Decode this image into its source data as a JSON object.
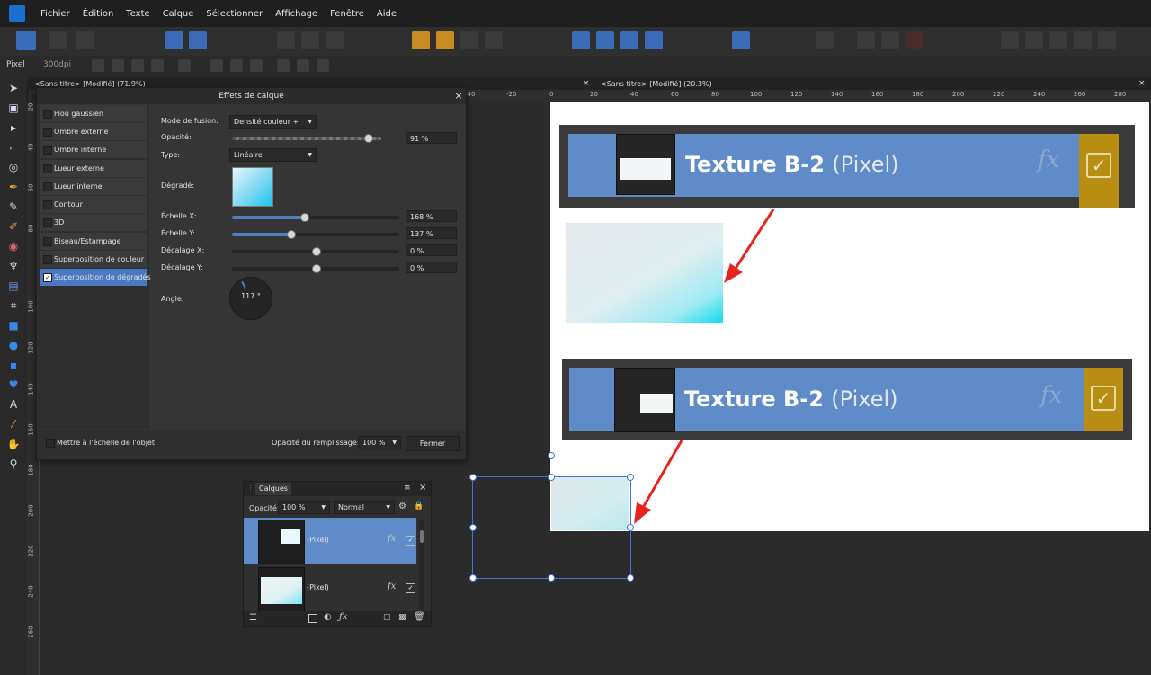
{
  "menubar": {
    "items": [
      "Fichier",
      "Édition",
      "Texte",
      "Calque",
      "Sélectionner",
      "Affichage",
      "Fenêtre",
      "Aide"
    ]
  },
  "contextbar": {
    "unit": "Pixel",
    "dpi": "300dpi"
  },
  "tabs": [
    {
      "label": "<Sans titre> [Modifié] (71.9%)"
    },
    {
      "label": "<Sans titre> [Modifié] (20.3%)"
    }
  ],
  "hruler": [
    "-40",
    "-20",
    "0",
    "20",
    "40",
    "60",
    "80",
    "100",
    "120",
    "140",
    "160",
    "180",
    "200",
    "220",
    "240",
    "260",
    "280"
  ],
  "vruler": [
    "20",
    "40",
    "60",
    "80",
    "100",
    "120",
    "140",
    "160",
    "180",
    "200",
    "220",
    "240",
    "260"
  ],
  "dialog": {
    "title": "Effets de calque",
    "close": "×",
    "effects": [
      {
        "label": "Flou gaussien",
        "checked": false
      },
      {
        "label": "Ombre externe",
        "checked": false
      },
      {
        "label": "Ombre interne",
        "checked": false
      },
      {
        "label": "Lueur externe",
        "checked": false
      },
      {
        "label": "Lueur interne",
        "checked": false
      },
      {
        "label": "Contour",
        "checked": false
      },
      {
        "label": "3D",
        "checked": false
      },
      {
        "label": "Biseau/Estampage",
        "checked": false
      },
      {
        "label": "Superposition de couleur",
        "checked": false
      },
      {
        "label": "Superposition de dégradés",
        "checked": true
      }
    ],
    "blend_label": "Mode de fusion:",
    "blend_value": "Densité couleur +",
    "opacity_label": "Opacité:",
    "opacity_value": "91 %",
    "opacity_level": 0.91,
    "type_label": "Type:",
    "type_value": "Linéaire",
    "gradient_label": "Dégradé:",
    "scale_x_label": "Échelle X:",
    "scale_x_value": "168 %",
    "scale_x_level": 0.43,
    "scale_y_label": "Échelle Y:",
    "scale_y_value": "137 %",
    "scale_y_level": 0.35,
    "offset_x_label": "Décalage X:",
    "offset_x_value": "0 %",
    "offset_x_level": 0.5,
    "offset_y_label": "Décalage Y:",
    "offset_y_value": "0 %",
    "offset_y_level": 0.5,
    "angle_label": "Angle:",
    "angle_value": "117 °",
    "scale_to_object": "Mettre à l'échelle de l'objet",
    "fill_opacity_label": "Opacité du remplissage:",
    "fill_opacity_value": "100 %",
    "close_button": "Fermer"
  },
  "canvas_strips": [
    {
      "name": "Texture B-2",
      "suffix": "(Pixel)",
      "fx": "fx",
      "check": "✓"
    },
    {
      "name": "Texture B-2",
      "suffix": "(Pixel)",
      "fx": "fx",
      "check": "✓"
    }
  ],
  "layers": {
    "title": "Calques",
    "opacity_label": "Opacité:",
    "opacity_value": "100 %",
    "blend_value": "Normal",
    "rows": [
      {
        "name": "(Pixel)",
        "fx": "fx",
        "check": "✓"
      },
      {
        "name": "(Pixel)",
        "fx": "fx",
        "check": "✓"
      }
    ],
    "menu_icon": "≡",
    "close": "×"
  },
  "colors": {
    "accent": "#4a78c2",
    "layer_blue": "#5f8cc9",
    "gold": "#b78e12",
    "arrow": "#e8231f"
  }
}
